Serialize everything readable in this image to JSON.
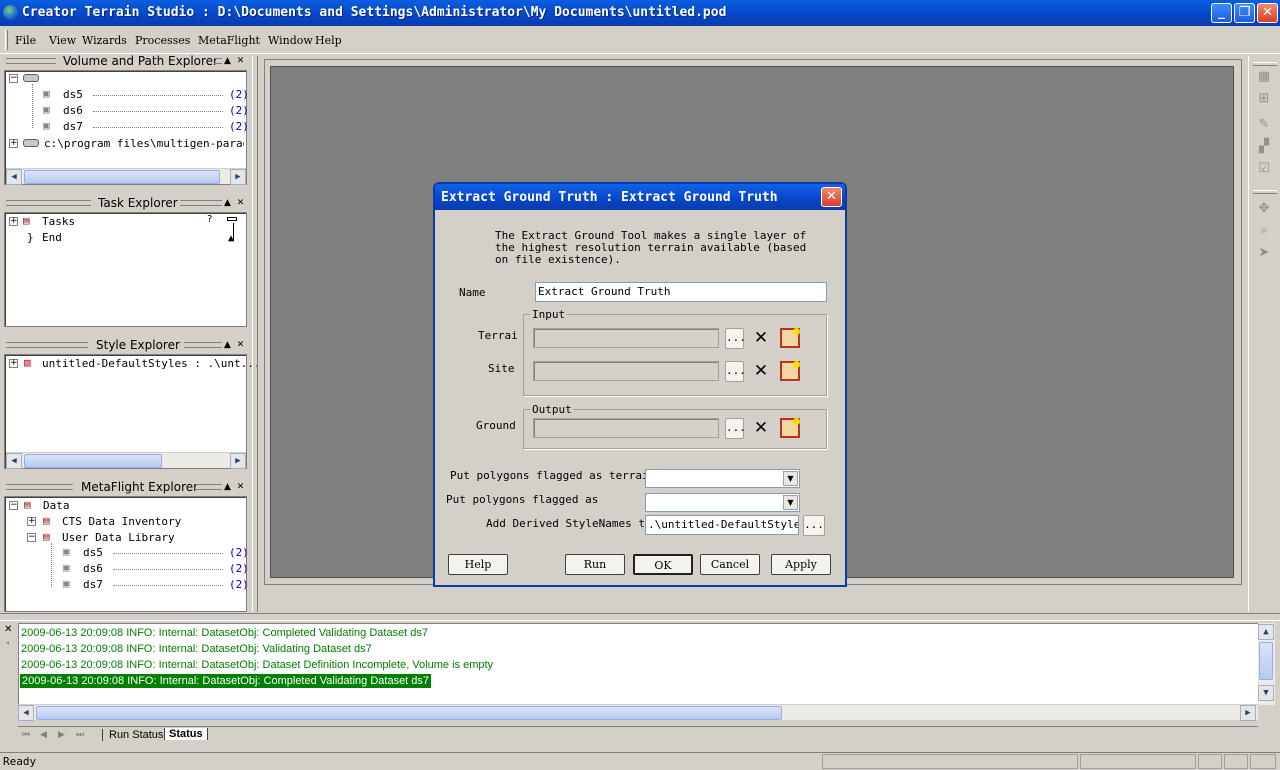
{
  "window": {
    "title": "Creator Terrain Studio : D:\\Documents and Settings\\Administrator\\My Documents\\untitled.pod"
  },
  "menu": [
    "File",
    "View",
    "Wizards",
    "Processes",
    "MetaFlight",
    "Window",
    "Help"
  ],
  "volume_explorer": {
    "title": "Volume and Path Explorer",
    "items": [
      {
        "label": "ds5",
        "count": "(2)"
      },
      {
        "label": "ds6",
        "count": "(2)"
      },
      {
        "label": "ds7",
        "count": "(2)"
      }
    ],
    "path": "c:\\program files\\multigen-paradigm"
  },
  "task_explorer": {
    "title": "Task Explorer",
    "items": [
      "Tasks",
      "End"
    ]
  },
  "style_explorer": {
    "title": "Style Explorer",
    "items": [
      "untitled-DefaultStyles : .\\unt..."
    ]
  },
  "metaflight_explorer": {
    "title": "MetaFlight Explorer",
    "root": "Data",
    "children": [
      "CTS Data Inventory",
      "User Data Library"
    ],
    "datasets": [
      {
        "label": "ds5",
        "count": "(2)"
      },
      {
        "label": "ds6",
        "count": "(2)"
      },
      {
        "label": "ds7",
        "count": "(2)"
      }
    ]
  },
  "dialog": {
    "title": "Extract Ground Truth : Extract Ground Truth",
    "description": "The Extract Ground Tool makes a single layer of the highest resolution terrain available (based on file existence).",
    "name_label": "Name",
    "name_value": "Extract Ground Truth",
    "input_group": "Input",
    "terrain_label": "Terrai",
    "site_label": "Site",
    "output_group": "Output",
    "ground_label": "Ground",
    "browse": "...",
    "terrain_polys_label": "Put polygons flagged as terrain",
    "polys_label": "Put polygons flagged as",
    "stylenames_label": "Add Derived StyleNames to",
    "stylenames_value": ".\\untitled-DefaultStyles.",
    "buttons": {
      "help": "Help",
      "run": "Run",
      "ok": "OK",
      "cancel": "Cancel",
      "apply": "Apply"
    }
  },
  "log": [
    "2009-06-13 20:09:08 INFO: Internal: DatasetObj: Completed Validating Dataset ds7",
    "2009-06-13 20:09:08 INFO: Internal: DatasetObj: Validating Dataset ds7",
    "2009-06-13 20:09:08 INFO: Internal: DatasetObj: Dataset Definition Incomplete, Volume is empty",
    "2009-06-13 20:09:08 INFO: Internal: DatasetObj: Completed Validating Dataset ds7"
  ],
  "log_tabs": [
    "Run Status",
    "Status"
  ],
  "status": "Ready"
}
